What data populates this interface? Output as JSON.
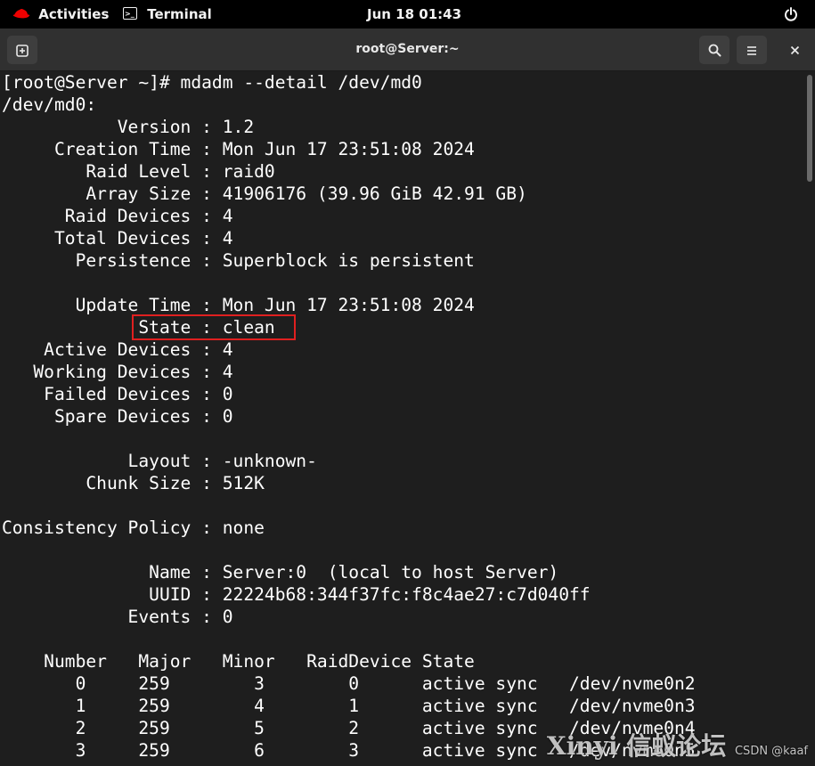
{
  "topbar": {
    "activities": "Activities",
    "app": "Terminal",
    "clock": "Jun 18  01:43"
  },
  "window": {
    "title": "root@Server:~"
  },
  "terminal": {
    "lines": [
      "[root@Server ~]# mdadm --detail /dev/md0",
      "/dev/md0:",
      "           Version : 1.2",
      "     Creation Time : Mon Jun 17 23:51:08 2024",
      "        Raid Level : raid0",
      "        Array Size : 41906176 (39.96 GiB 42.91 GB)",
      "      Raid Devices : 4",
      "     Total Devices : 4",
      "       Persistence : Superblock is persistent",
      "",
      "       Update Time : Mon Jun 17 23:51:08 2024",
      "             State : clean",
      "    Active Devices : 4",
      "   Working Devices : 4",
      "    Failed Devices : 0",
      "     Spare Devices : 0",
      "",
      "            Layout : -unknown-",
      "        Chunk Size : 512K",
      "",
      "Consistency Policy : none",
      "",
      "              Name : Server:0  (local to host Server)",
      "              UUID : 22224b68:344f37fc:f8c4ae27:c7d040ff",
      "            Events : 0",
      "",
      "    Number   Major   Minor   RaidDevice State",
      "       0     259        3        0      active sync   /dev/nvme0n2",
      "       1     259        4        1      active sync   /dev/nvme0n3",
      "       2     259        5        2      active sync   /dev/nvme0n4",
      "       3     259        6        3      active sync   /dev/nvme0n5"
    ]
  },
  "watermark": {
    "text": "Xinyi 信蚁论坛",
    "sub": "CSDN @kaaf"
  },
  "colors": {
    "highlight": "#e02020",
    "terminal_bg": "#1e1e1e",
    "terminal_fg": "#ffffff"
  }
}
